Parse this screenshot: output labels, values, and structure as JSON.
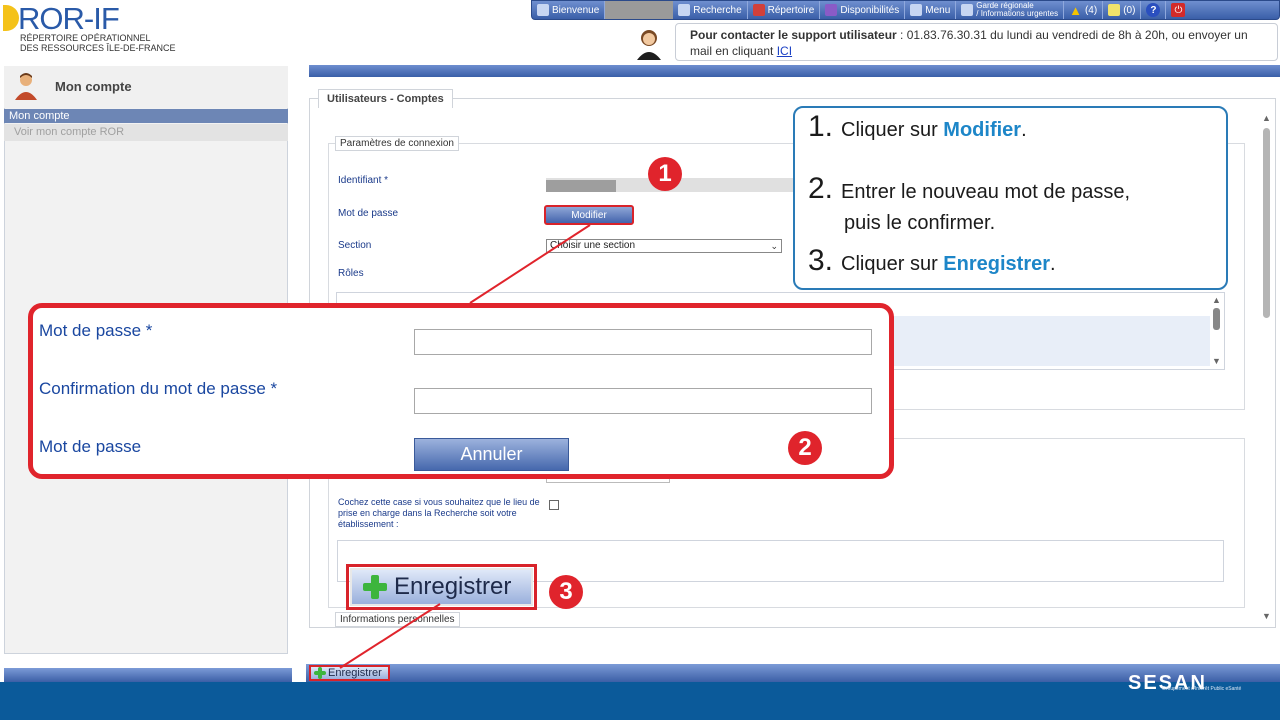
{
  "header": {
    "logo_title": "ROR-IF",
    "logo_subtitle_line1": "RÉPERTOIRE OPÉRATIONNEL",
    "logo_subtitle_line2": "DES RESSOURCES ÎLE-DE-FRANCE",
    "nav": {
      "bienvenue": "Bienvenue",
      "recherche": "Recherche",
      "repertoire": "Répertoire",
      "disponibilites": "Disponibilités",
      "menu": "Menu",
      "garde_line1": "Garde régionale",
      "garde_line2": "/ Informations urgentes",
      "alerts_count": "(4)",
      "messages_count": "(0)",
      "help": "?",
      "power": "⏻"
    },
    "support": {
      "bold": "Pour contacter le support utilisateur",
      "text": " : 01.83.76.30.31 du lundi au vendredi de 8h à 20h, ou envoyer un mail en cliquant ",
      "link": "ICI"
    }
  },
  "sidebar": {
    "title": "Mon compte",
    "active_item": "Mon compte",
    "link": "Voir mon compte ROR"
  },
  "main": {
    "tab": "Utilisateurs - Comptes",
    "connexion_legend": "Paramètres de connexion",
    "identifiant_label": "Identifiant *",
    "motdepasse_label": "Mot de passe",
    "modifier_button": "Modifier",
    "section_label": "Section",
    "section_select": "Choisir une section",
    "roles_label": "Rôles",
    "checkbox_text": "Cochez cette case si vous souhaitez que le lieu de prise en charge dans la Recherche soit votre établissement :",
    "enregistrer_big": "Enregistrer",
    "infos_legend": "Informations personnelles",
    "enregistrer_small": "Enregistrer"
  },
  "popup": {
    "mdp_label": "Mot de passe *",
    "confirm_label": "Confirmation du mot de passe *",
    "mdp_label2": "Mot de passe",
    "annuler_button": "Annuler"
  },
  "badges": {
    "one": "1",
    "two": "2",
    "three": "3"
  },
  "instructions": {
    "step1_num": "1.",
    "step1_pre": "Cliquer sur ",
    "step1_kw": "Modifier",
    "step1_post": ".",
    "step2_num": "2.",
    "step2_line1": "Entrer le nouveau mot de passe,",
    "step2_line2": "puis le confirmer.",
    "step3_num": "3.",
    "step3_pre": "Cliquer sur ",
    "step3_kw": "Enregistrer",
    "step3_post": "."
  },
  "footer": {
    "logo": "SESAN",
    "sub": "Groupement d'Intérêt Public eSanté"
  },
  "colors": {
    "accent_red": "#e0242c",
    "nav_blue": "#3a5fa8",
    "instruction_blue": "#1d86c8",
    "footer_blue": "#0b5a9a"
  },
  "icons": [
    "user-icon",
    "search-arrow-icon",
    "book-icon",
    "availability-icon",
    "menu-icon",
    "garde-icon",
    "warning-icon",
    "message-icon",
    "help-icon",
    "power-icon",
    "support-avatar-icon",
    "account-avatar-icon",
    "plus-icon"
  ]
}
